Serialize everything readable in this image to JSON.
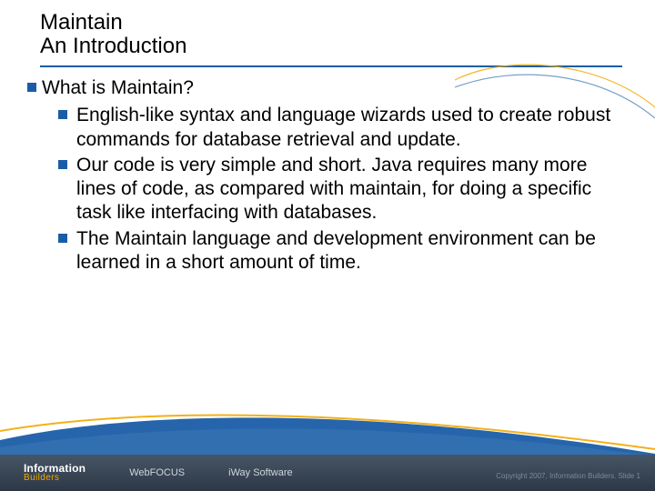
{
  "header": {
    "title_line1": "Maintain",
    "title_line2": "An Introduction"
  },
  "content": {
    "heading": "What is Maintain?",
    "bullets": [
      "English-like syntax and language wizards used to create robust commands for database retrieval and update.",
      "Our code is very simple and short. Java requires many more lines of code, as compared with maintain, for doing a specific task like interfacing with databases.",
      "The Maintain language and development environment can be learned in a short amount of time."
    ]
  },
  "footer": {
    "brand_primary_top": "Information",
    "brand_primary_bottom": "Builders",
    "brand_wf": "WebFOCUS",
    "brand_iway": "iWay Software",
    "copyright": "Copyright 2007, Information Builders. Slide 1"
  },
  "colors": {
    "accent": "#1a5da6",
    "footer_bg_top": "#475566",
    "footer_bg_bottom": "#2d3846",
    "gold": "#f2a900"
  }
}
